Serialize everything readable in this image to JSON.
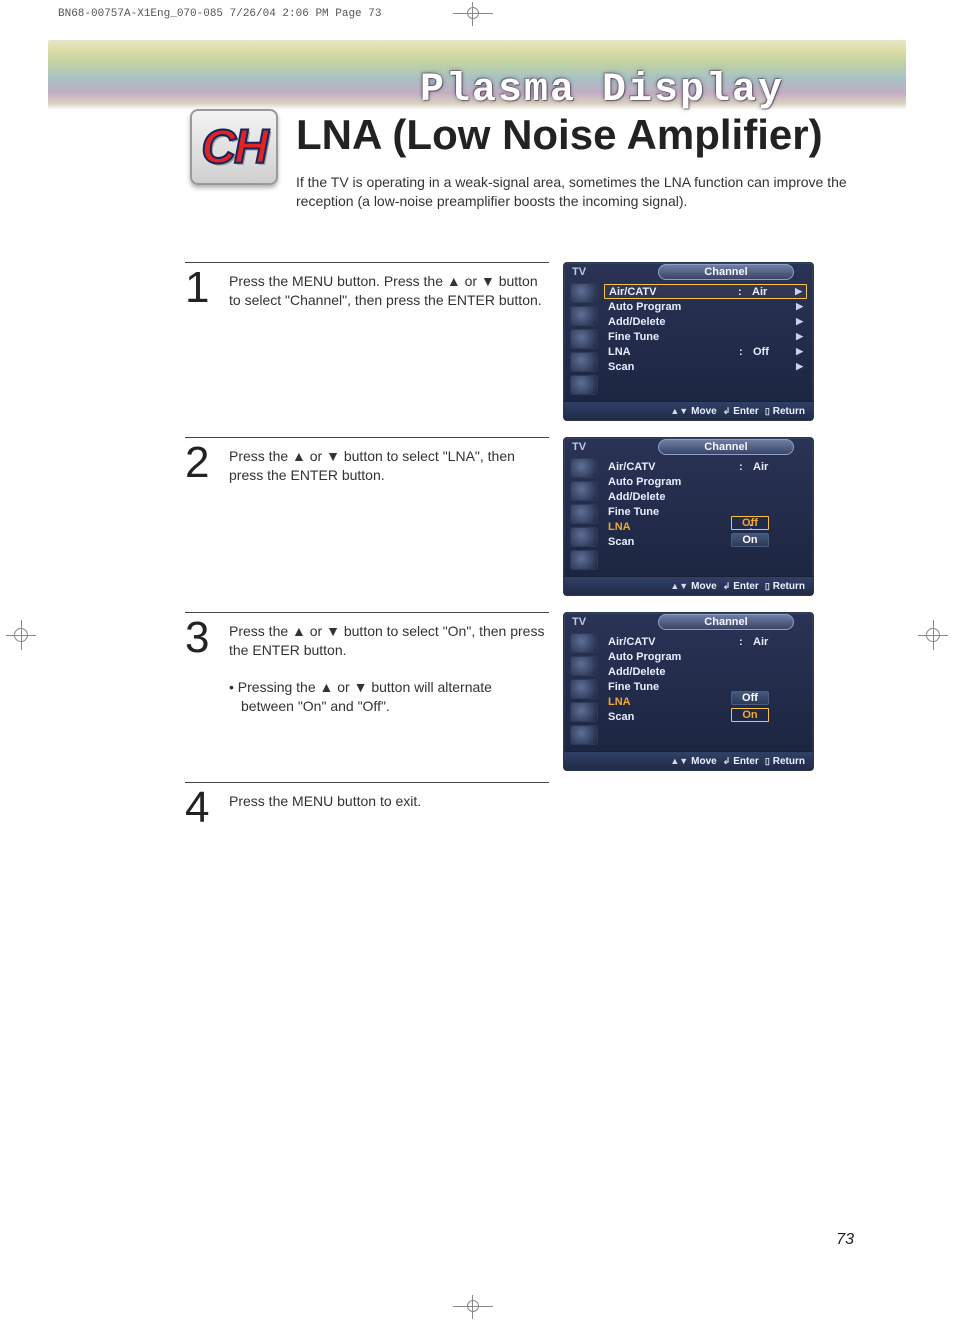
{
  "print_meta": "BN68-00757A-X1Eng_070-085  7/26/04  2:06 PM  Page 73",
  "banner_title": "Plasma Display",
  "badge": "CH",
  "title": "LNA (Low Noise Amplifier)",
  "intro": "If the TV is operating in a weak-signal area, sometimes the LNA function can improve the reception (a low-noise preamplifier boosts the incoming signal).",
  "steps": {
    "s1": {
      "num": "1",
      "text": "Press the MENU button. Press the ▲ or ▼ button to select \"Channel\", then press the ENTER button."
    },
    "s2": {
      "num": "2",
      "text": "Press the ▲ or ▼ button to select \"LNA\", then press the ENTER button."
    },
    "s3": {
      "num": "3",
      "text": "Press the ▲ or ▼ button to select \"On\", then press the ENTER button.",
      "bullet": "• Pressing the ▲ or ▼ button will alternate between \"On\" and \"Off\"."
    },
    "s4": {
      "num": "4",
      "text": "Press the MENU button to exit."
    }
  },
  "osd": {
    "tv": "TV",
    "tab": "Channel",
    "items": {
      "aircatv": "Air/CATV",
      "autoprog": "Auto Program",
      "adddel": "Add/Delete",
      "finetune": "Fine Tune",
      "lna": "LNA",
      "scan": "Scan"
    },
    "air_val": "Air",
    "off_val": "Off",
    "on_val": "On",
    "footer": {
      "move": "Move",
      "enter": "Enter",
      "return": "Return"
    }
  },
  "page_number": "73"
}
